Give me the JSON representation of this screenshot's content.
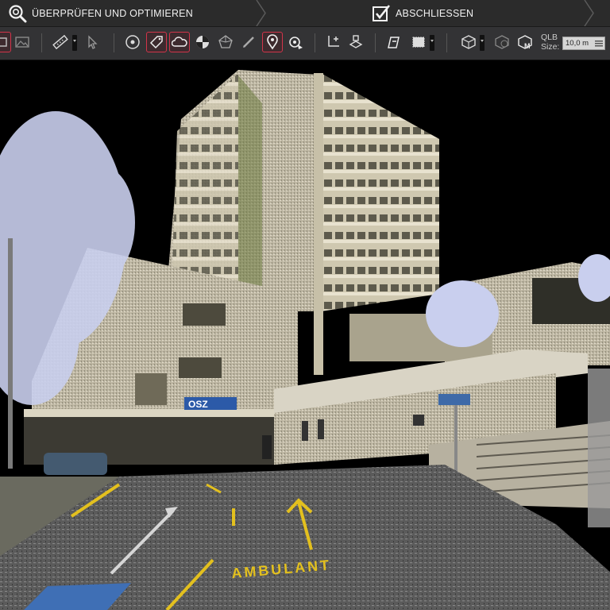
{
  "steps": {
    "review": {
      "label": "ÜBERPRÜFEN UND OPTIMIEREN",
      "icon": "magnifier-check-icon"
    },
    "finalize": {
      "label": "ABSCHLIESSEN",
      "icon": "checkbox-check-icon"
    }
  },
  "toolbar": {
    "qlb_label_line1": "QLB",
    "qlb_label_line2": "Size:",
    "qlb_size_value": "10,0 m"
  },
  "scene": {
    "sign_text": "OSZ",
    "road_marking_text": "AMBULANT"
  },
  "colors": {
    "bar_bg": "#2b2b2b",
    "toolbar_bg": "#333335",
    "active_border": "#d2344a",
    "road_marking_yellow": "#e3c01e",
    "tree_blue": "#c9cfee"
  }
}
